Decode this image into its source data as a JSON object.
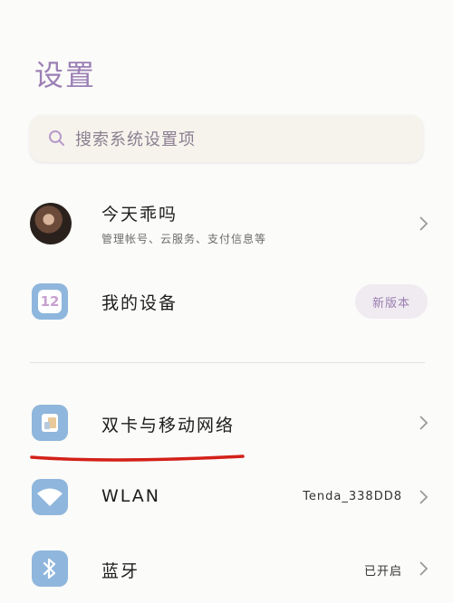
{
  "header": {
    "title": "设置"
  },
  "search": {
    "placeholder": "搜索系统设置项",
    "icon": "search-icon"
  },
  "account": {
    "name": "今天乖吗",
    "subtitle": "管理帐号、云服务、支付信息等"
  },
  "device": {
    "label": "我的设备",
    "icon_text": "12",
    "badge": "新版本"
  },
  "network": {
    "sim": {
      "label": "双卡与移动网络",
      "icon": "sim-card-icon"
    },
    "wlan": {
      "label": "WLAN",
      "value": "Tenda_338DD8",
      "icon": "wifi-icon"
    },
    "bluetooth": {
      "label": "蓝牙",
      "value": "已开启",
      "icon": "bluetooth-icon"
    }
  },
  "colors": {
    "accent": "#9b7fb5",
    "icon_bg": "#8fb6dc",
    "annotation_red": "#d32018"
  }
}
